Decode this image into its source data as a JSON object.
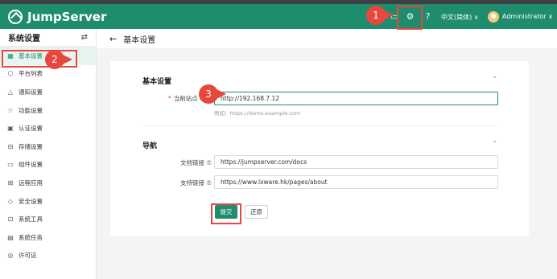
{
  "app": {
    "name": "JumpServer"
  },
  "topbar": {
    "language": "中文(简体) ∨",
    "user": "Administrator ∨",
    "icons": [
      "message-icon",
      "settings-icon",
      "help-icon"
    ]
  },
  "sidebar": {
    "title": "系统设置",
    "items": [
      {
        "label": "基本设置",
        "icon": "grid-icon",
        "active": true
      },
      {
        "label": "平台列表",
        "icon": "cube-icon"
      },
      {
        "label": "通知设置",
        "icon": "bell-icon"
      },
      {
        "label": "功能设置",
        "icon": "star-icon"
      },
      {
        "label": "认证设置",
        "icon": "id-card-icon"
      },
      {
        "label": "存储设置",
        "icon": "storage-icon"
      },
      {
        "label": "组件设置",
        "icon": "monitor-icon"
      },
      {
        "label": "远程应用",
        "icon": "apps-icon"
      },
      {
        "label": "安全设置",
        "icon": "shield-icon"
      },
      {
        "label": "系统工具",
        "icon": "toolbox-icon"
      },
      {
        "label": "系统任务",
        "icon": "task-icon"
      },
      {
        "label": "许可证",
        "icon": "license-icon"
      }
    ]
  },
  "breadcrumb": {
    "title": "基本设置"
  },
  "form": {
    "basic": {
      "title": "基本设置",
      "site_url_label": "当前站点 URL",
      "site_url_value": "http://192.168.7.12",
      "site_url_hint": "例如：https://demo.example.com"
    },
    "nav": {
      "title": "导航",
      "docs_label": "文档链接 ⑦",
      "docs_value": "https://jumpserver.com/docs",
      "support_label": "支持链接 ⑦",
      "support_value": "https://www.lxware.hk/pages/about"
    },
    "submit_label": "提交",
    "reset_label": "还原"
  },
  "annotations": [
    "1",
    "2",
    "3"
  ],
  "colors": {
    "brand": "#1f8c6e",
    "callout": "#e8473d"
  }
}
